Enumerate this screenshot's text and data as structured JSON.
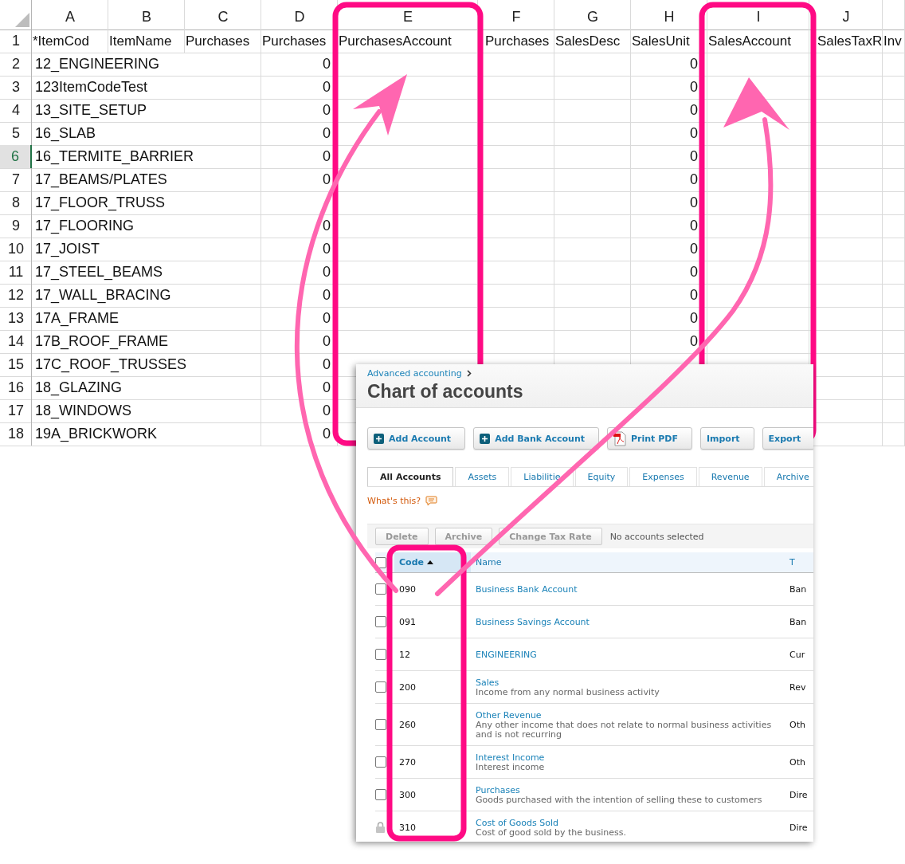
{
  "sheet": {
    "column_letters": [
      "A",
      "B",
      "C",
      "D",
      "E",
      "F",
      "G",
      "H",
      "I",
      "J"
    ],
    "header_row": {
      "number": "1",
      "selected": false,
      "cells": [
        "*ItemCod",
        "ItemName",
        "Purchases",
        "Purchases",
        "PurchasesAccount",
        "Purchases",
        "SalesDesc",
        "SalesUnit",
        "SalesAccount",
        "SalesTaxR",
        "Inv"
      ]
    },
    "rows": [
      {
        "number": "2",
        "selected": false,
        "item_code": "12_ENGINEERING",
        "column_d": "0",
        "column_h": "0"
      },
      {
        "number": "3",
        "selected": false,
        "item_code": "123ItemCodeTest",
        "column_d": "0",
        "column_h": "0"
      },
      {
        "number": "4",
        "selected": false,
        "item_code": "13_SITE_SETUP",
        "column_d": "0",
        "column_h": "0"
      },
      {
        "number": "5",
        "selected": false,
        "item_code": "16_SLAB",
        "column_d": "0",
        "column_h": "0"
      },
      {
        "number": "6",
        "selected": true,
        "item_code": "16_TERMITE_BARRIER",
        "column_d": "0",
        "column_h": "0"
      },
      {
        "number": "7",
        "selected": false,
        "item_code": "17_BEAMS/PLATES",
        "column_d": "0",
        "column_h": "0"
      },
      {
        "number": "8",
        "selected": false,
        "item_code": "17_FLOOR_TRUSS",
        "column_h": "0"
      },
      {
        "number": "9",
        "selected": false,
        "item_code": "17_FLOORING",
        "column_d": "0",
        "column_h": "0"
      },
      {
        "number": "10",
        "selected": false,
        "item_code": "17_JOIST",
        "column_d": "0",
        "column_h": "0"
      },
      {
        "number": "11",
        "selected": false,
        "item_code": "17_STEEL_BEAMS",
        "column_d": "0",
        "column_h": "0"
      },
      {
        "number": "12",
        "selected": false,
        "item_code": "17_WALL_BRACING",
        "column_d": "0",
        "column_h": "0"
      },
      {
        "number": "13",
        "selected": false,
        "item_code": "17A_FRAME",
        "column_d": "0",
        "column_h": "0"
      },
      {
        "number": "14",
        "selected": false,
        "item_code": "17B_ROOF_FRAME",
        "column_d": "0",
        "column_h": "0"
      },
      {
        "number": "15",
        "selected": false,
        "item_code": "17C_ROOF_TRUSSES",
        "column_d": "0"
      },
      {
        "number": "16",
        "selected": false,
        "item_code": "18_GLAZING",
        "column_d": "0"
      },
      {
        "number": "17",
        "selected": false,
        "item_code": "18_WINDOWS",
        "column_d": "0"
      },
      {
        "number": "18",
        "selected": false,
        "item_code": "19A_BRICKWORK",
        "column_d": "0"
      }
    ]
  },
  "panel": {
    "breadcrumb": "Advanced accounting",
    "title": "Chart of accounts",
    "buttons": [
      {
        "label": "Add Account",
        "kind": "plus"
      },
      {
        "label": "Add Bank Account",
        "kind": "plus"
      },
      {
        "label": "Print PDF",
        "kind": "pdf"
      },
      {
        "label": "Import",
        "kind": "plain"
      },
      {
        "label": "Export",
        "kind": "plain"
      }
    ],
    "tabs": [
      {
        "label": "All Accounts",
        "selected": true
      },
      {
        "label": "Assets",
        "selected": false
      },
      {
        "label": "Liabilitie",
        "selected": false
      },
      {
        "label": "Equity",
        "selected": false
      },
      {
        "label": "Expenses",
        "selected": false
      },
      {
        "label": "Revenue",
        "selected": false
      },
      {
        "label": "Archive",
        "selected": false
      }
    ],
    "help_link": "What's this?",
    "actions": [
      {
        "label": "Delete",
        "disabled": true
      },
      {
        "label": "Archive",
        "disabled": true
      },
      {
        "label": "Change Tax Rate",
        "disabled": true
      }
    ],
    "selection_status": "No accounts selected",
    "table": {
      "select_all_checked": false,
      "columns": [
        {
          "label": "Code",
          "sorted": true
        },
        {
          "label": "Name",
          "sorted": false
        },
        {
          "label": "T",
          "sorted": false
        }
      ],
      "rows": [
        {
          "kind": "checkbox",
          "checked": false,
          "code": "090",
          "name": "Business Bank Account",
          "type": "Ban"
        },
        {
          "kind": "checkbox",
          "checked": false,
          "code": "091",
          "name": "Business Savings Account",
          "type": "Ban"
        },
        {
          "kind": "checkbox",
          "checked": false,
          "code": "12",
          "name": "ENGINEERING",
          "type": "Cur"
        },
        {
          "kind": "checkbox",
          "checked": false,
          "code": "200",
          "name": "Sales",
          "description": "Income from any normal business activity",
          "type": "Rev"
        },
        {
          "kind": "checkbox",
          "checked": false,
          "code": "260",
          "name": "Other Revenue",
          "description": "Any other income that does not relate to normal business activities and is not recurring",
          "type": "Oth"
        },
        {
          "kind": "checkbox",
          "checked": false,
          "code": "270",
          "name": "Interest Income",
          "description": "Interest income",
          "type": "Oth"
        },
        {
          "kind": "checkbox",
          "checked": false,
          "code": "300",
          "name": "Purchases",
          "description": "Goods purchased with the intention of selling these to customers",
          "type": "Dire"
        },
        {
          "kind": "locked",
          "code": "310",
          "name": "Cost of Goods Sold",
          "description": "Cost of good sold by the business.",
          "type": "Dire"
        }
      ]
    }
  }
}
